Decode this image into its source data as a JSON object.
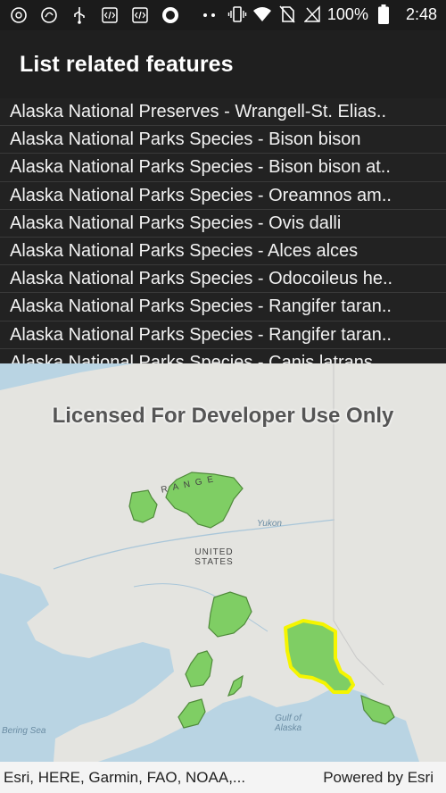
{
  "status_bar": {
    "battery_percent": "100%",
    "time": "2:48",
    "left_icons": [
      "app-grid-icon",
      "chrome-icon",
      "usb-icon",
      "code-icon",
      "code-icon",
      "record-icon",
      "more-dots-icon"
    ],
    "right_icons": [
      "vibrate-icon",
      "wifi-icon",
      "no-sim-icon",
      "signal-icon",
      "battery-icon"
    ]
  },
  "toolbar": {
    "title": "List related features"
  },
  "list": {
    "items": [
      "Alaska National Preserves - Wrangell-St. Elias..",
      "Alaska National Parks Species - Bison bison",
      "Alaska National Parks Species - Bison bison at..",
      "Alaska National Parks Species - Oreamnos am..",
      "Alaska National Parks Species - Ovis dalli",
      "Alaska National Parks Species - Alces alces",
      "Alaska National Parks Species - Odocoileus he..",
      "Alaska National Parks Species - Rangifer taran..",
      "Alaska National Parks Species - Rangifer taran..",
      "Alaska National Parks Species - Canis latrans"
    ]
  },
  "map": {
    "watermark": "Licensed For Developer Use Only",
    "labels": {
      "range": "RANGE",
      "yukon": "Yukon",
      "united_states_1": "UNITED",
      "united_states_2": "STATES",
      "gulf_1": "Gulf of",
      "gulf_2": "Alaska",
      "bering": "Bering Sea"
    },
    "colors": {
      "park_fill": "#7fce64",
      "highlight": "#f5f500",
      "water": "#b9d4e3",
      "land": "#e4e4e0"
    }
  },
  "attribution": {
    "sources": "Esri, HERE, Garmin, FAO, NOAA,...",
    "powered_by": "Powered by Esri"
  }
}
